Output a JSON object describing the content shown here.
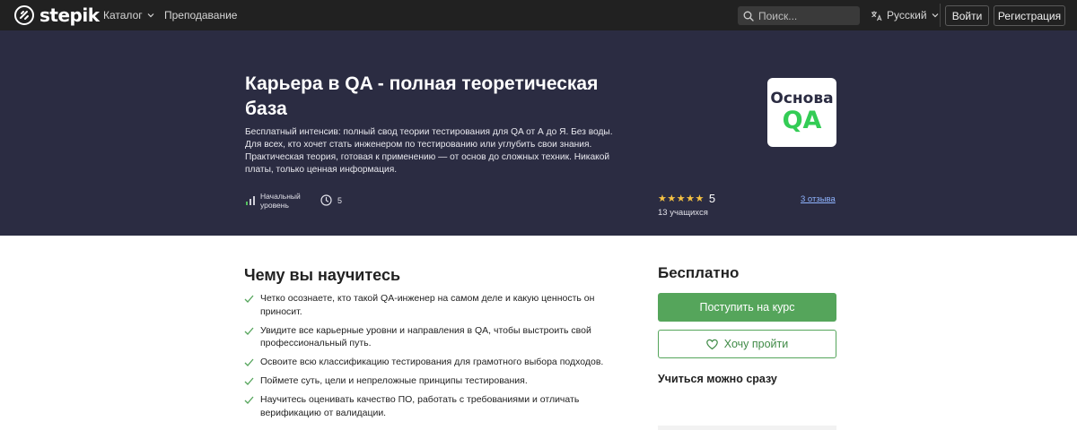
{
  "topbar": {
    "logo_text": "stepik",
    "nav": [
      {
        "label": "Каталог",
        "has_dropdown": true
      },
      {
        "label": "Преподавание",
        "has_dropdown": false
      }
    ],
    "search_placeholder": "Поиск...",
    "language": "Русский",
    "login_label": "Войти",
    "register_label": "Регистрация"
  },
  "hero": {
    "title": "Карьера в QA - полная теоретическая база",
    "description": "Бесплатный интенсив: полный свод теории тестирования для QA от А до Я. Без воды. Для всех, кто хочет стать инженером по тестированию или углубить свои знания. Практическая теория, готовая к применению — от основ до сложных техник. Никакой платы, только ценная информация.",
    "level": "Начальный уровень",
    "duration": "5",
    "logo_line1": "Основа",
    "logo_line2": "QA",
    "stars": "★★★★★",
    "rating": "5",
    "students": "13 учащихся",
    "reviews": "3 отзыва"
  },
  "learn": {
    "title": "Чему вы научитесь",
    "items": [
      "Четко осознаете, кто такой QA-инженер на самом деле и какую ценность он приносит.",
      "Увидите все карьерные уровни и направления в QA, чтобы выстроить свой профессиональный путь.",
      "Освоите всю классификацию тестирования для грамотного выбора подходов.",
      "Поймете суть, цели и непреложные принципы тестирования.",
      "Научитесь оценивать качество ПО, работать с требованиями и отличать верификацию от валидации."
    ]
  },
  "sidebar": {
    "price": "Бесплатно",
    "enroll_label": "Поступить на курс",
    "wishlist_label": "Хочу пройти",
    "start_note": "Учиться можно сразу"
  },
  "colors": {
    "topbar": "#212121",
    "hero": "#2b2c42",
    "accent_green": "#55a55b",
    "star": "#f6c343",
    "link": "#8fb4ff"
  }
}
